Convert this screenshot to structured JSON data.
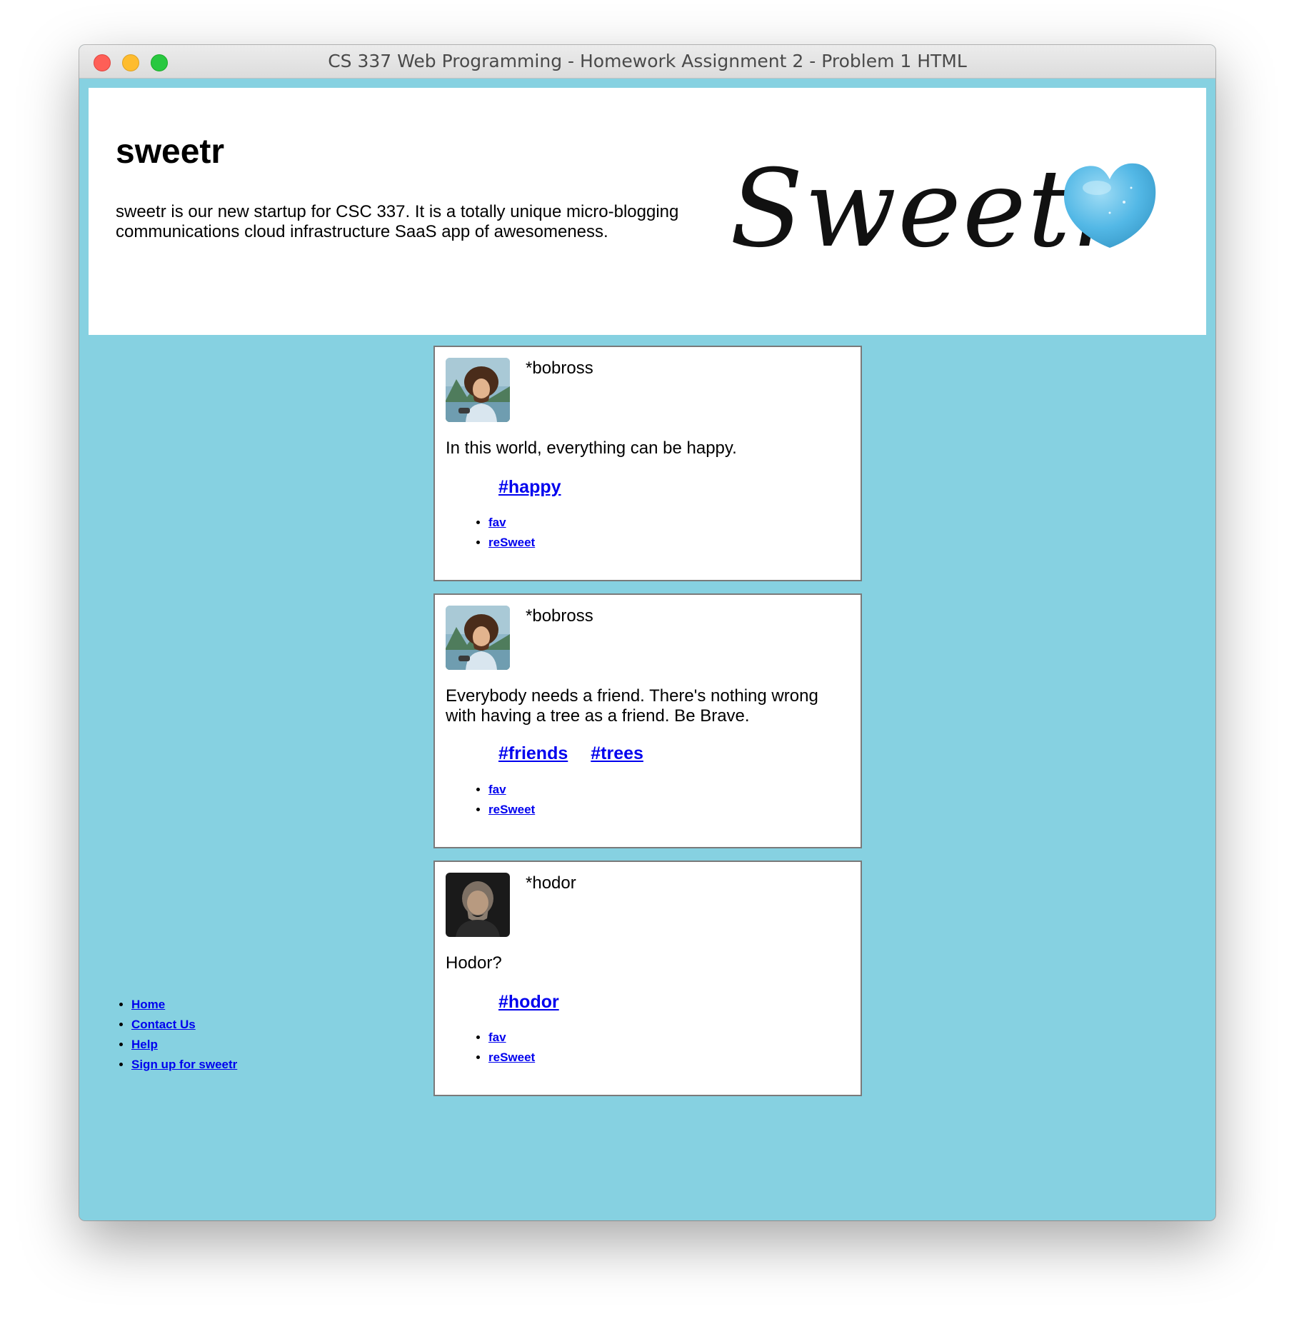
{
  "window": {
    "title": "CS 337 Web Programming - Homework Assignment 2 - Problem 1 HTML"
  },
  "header": {
    "site_title": "sweetr",
    "description": "sweetr is our new startup for CSC 337. It is a totally unique micro-blogging communications cloud infrastructure SaaS app of awesomeness.",
    "logo_text": "Sweetr",
    "logo_icon": "blue-heart-candy-icon"
  },
  "sweets": [
    {
      "username": "*bobross",
      "avatar": "bobross-avatar",
      "text": "In this world, everything can be happy.",
      "tags": [
        "#happy"
      ],
      "actions": [
        "fav",
        "reSweet"
      ]
    },
    {
      "username": "*bobross",
      "avatar": "bobross-avatar",
      "text": "Everybody needs a friend. There's nothing wrong with having a tree as a friend. Be Brave.",
      "tags": [
        "#friends",
        "#trees"
      ],
      "actions": [
        "fav",
        "reSweet"
      ]
    },
    {
      "username": "*hodor",
      "avatar": "hodor-avatar",
      "text": "Hodor?",
      "tags": [
        "#hodor"
      ],
      "actions": [
        "fav",
        "reSweet"
      ]
    }
  ],
  "footer": {
    "links": [
      "Home",
      "Contact Us",
      "Help",
      "Sign up for sweetr"
    ]
  },
  "colors": {
    "page_background": "#86d1e1",
    "card_background": "#ffffff",
    "link": "#0000ee",
    "card_border": "#7a7a7a"
  }
}
